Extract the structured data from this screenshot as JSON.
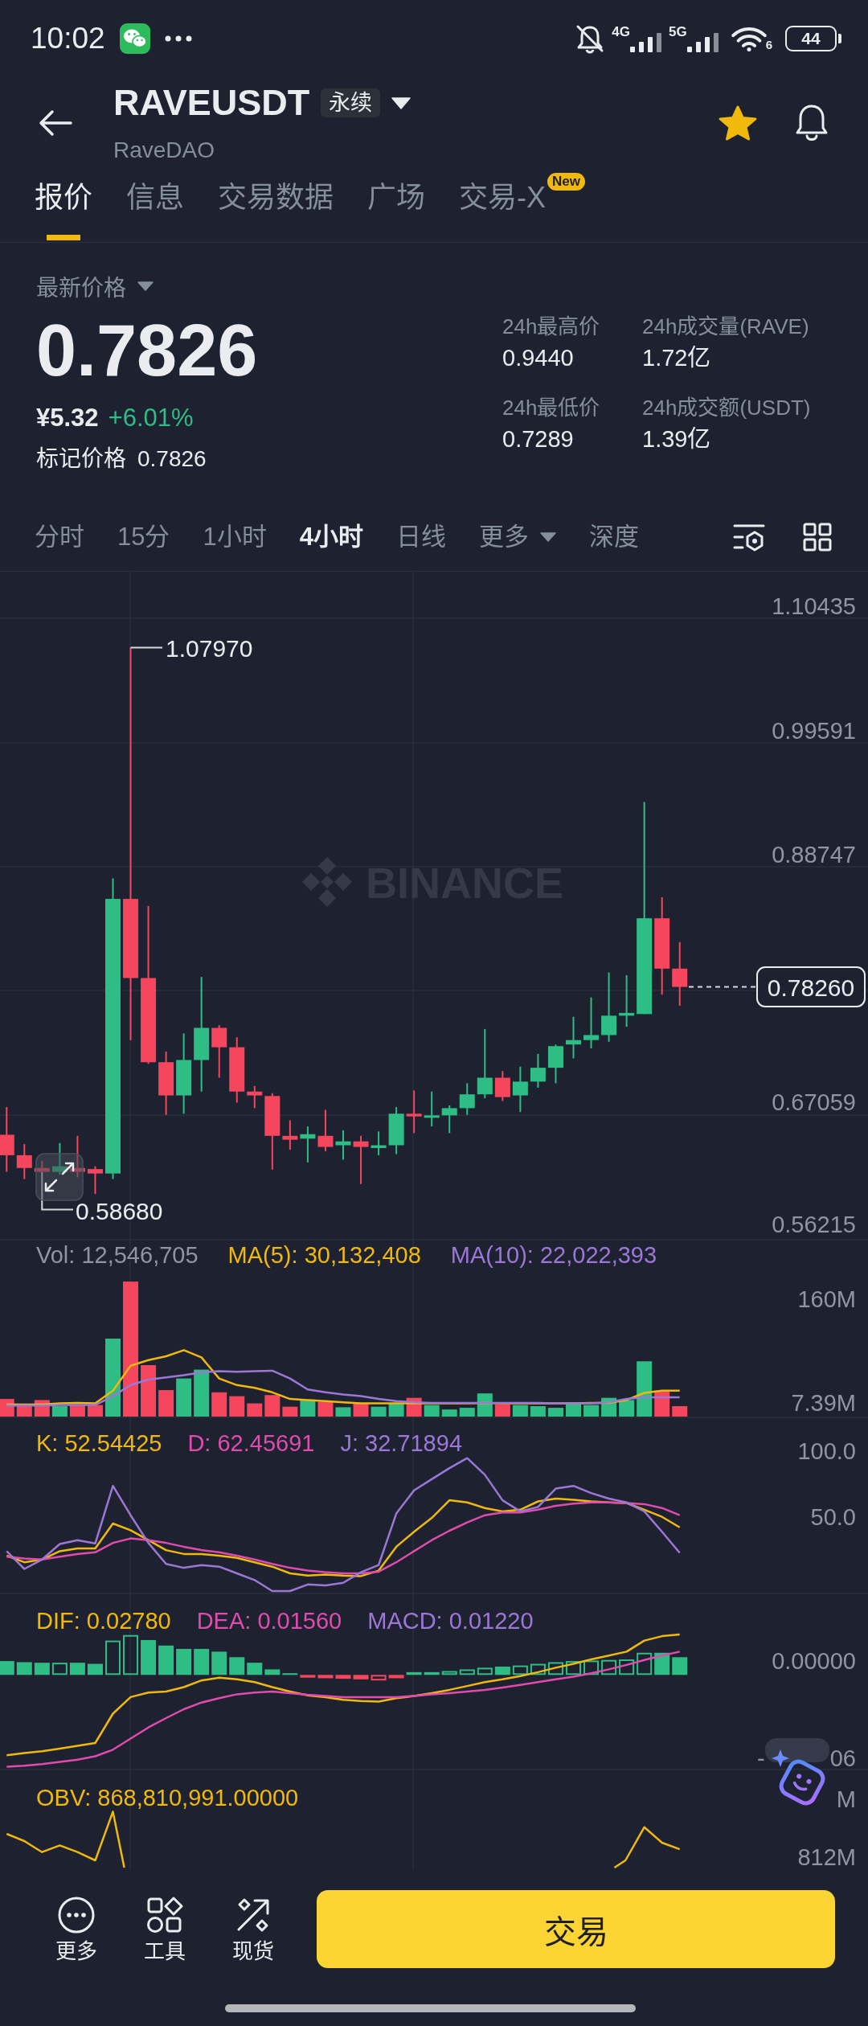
{
  "status_bar": {
    "time": "10:02",
    "networks": [
      "4G",
      "5G"
    ],
    "wifi_label": "6",
    "battery": "44"
  },
  "header": {
    "symbol": "RAVEUSDT",
    "badge": "永续",
    "subtitle": "RaveDAO",
    "favorite": true
  },
  "tabs": [
    {
      "label": "报价",
      "selected": true
    },
    {
      "label": "信息",
      "selected": false
    },
    {
      "label": "交易数据",
      "selected": false
    },
    {
      "label": "广场",
      "selected": false
    },
    {
      "label": "交易-X",
      "selected": false,
      "badge": "New"
    }
  ],
  "price": {
    "label": "最新价格",
    "last": "0.7826",
    "cny": "¥5.32",
    "change": "+6.01%",
    "rising": true,
    "mark_label": "标记价格",
    "mark": "0.7826"
  },
  "stats": [
    {
      "label": "24h最高价",
      "value": "0.9440"
    },
    {
      "label": "24h成交量(RAVE)",
      "value": "1.72亿"
    },
    {
      "label": "24h最低价",
      "value": "0.7289"
    },
    {
      "label": "24h成交额(USDT)",
      "value": "1.39亿"
    }
  ],
  "intervals": [
    {
      "label": "分时",
      "kind": "plain",
      "selected": false
    },
    {
      "label": "15分",
      "kind": "plain",
      "selected": false
    },
    {
      "label": "1小时",
      "kind": "plain",
      "selected": false
    },
    {
      "label": "4小时",
      "kind": "plain",
      "selected": true
    },
    {
      "label": "日线",
      "kind": "plain",
      "selected": false
    },
    {
      "label": "更多",
      "kind": "menu",
      "selected": false
    },
    {
      "label": "深度",
      "kind": "plain",
      "selected": false
    }
  ],
  "price_chart": {
    "watermark": "BINANCE",
    "axis_labels": [
      "1.10435",
      "0.99591",
      "0.88747",
      "0.67059",
      "0.56215"
    ],
    "high_label": "1.07970",
    "low_label": "0.58680",
    "last_price": "0.78260"
  },
  "volume": {
    "legend": [
      {
        "text": "Vol: 12,546,705",
        "color": "#8f96a3"
      },
      {
        "text": "MA(5): 30,132,408",
        "color": "#f0b90b"
      },
      {
        "text": "MA(10): 22,022,393",
        "color": "#9b78d6"
      }
    ],
    "axis_labels": [
      "160M",
      "7.39M"
    ]
  },
  "kdj": {
    "legend": [
      {
        "text": "K: 52.54425",
        "color": "#f0b90b"
      },
      {
        "text": "D: 62.45691",
        "color": "#df4cad"
      },
      {
        "text": "J: 32.71894",
        "color": "#9b78d6"
      }
    ],
    "axis_labels": [
      "100.0",
      "50.0"
    ]
  },
  "macd": {
    "legend": [
      {
        "text": "DIF: 0.02780",
        "color": "#f0b90b"
      },
      {
        "text": "DEA: 0.01560",
        "color": "#df4cad"
      },
      {
        "text": "MACD: 0.01220",
        "color": "#9b78d6"
      }
    ],
    "axis_labels": [
      "0.00000"
    ],
    "axis_fragments": [
      "-",
      "06"
    ]
  },
  "obv": {
    "legend": [
      {
        "text": "OBV: 868,810,991.00000",
        "color": "#f0b90b"
      }
    ],
    "axis_labels": [
      "M",
      "812M"
    ]
  },
  "bottom_bar": {
    "actions": [
      {
        "label": "更多",
        "kind": "more"
      },
      {
        "label": "工具",
        "kind": "tools"
      },
      {
        "label": "现货",
        "kind": "spot"
      }
    ],
    "trade_button": "交易"
  }
}
